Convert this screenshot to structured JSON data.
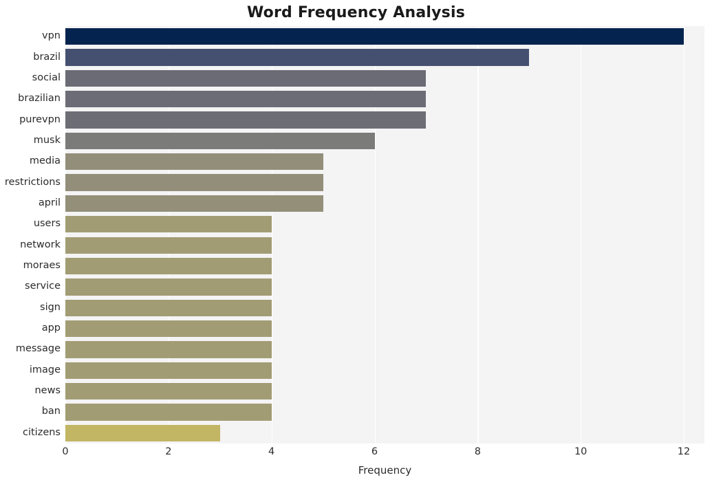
{
  "chart_data": {
    "type": "bar",
    "orientation": "horizontal",
    "title": "Word Frequency Analysis",
    "xlabel": "Frequency",
    "ylabel": "",
    "categories": [
      "vpn",
      "brazil",
      "social",
      "brazilian",
      "purevpn",
      "musk",
      "media",
      "restrictions",
      "april",
      "users",
      "network",
      "moraes",
      "service",
      "sign",
      "app",
      "message",
      "image",
      "news",
      "ban",
      "citizens"
    ],
    "values": [
      12,
      9,
      7,
      7,
      7,
      6,
      5,
      5,
      5,
      4,
      4,
      4,
      4,
      4,
      4,
      4,
      4,
      4,
      4,
      3
    ],
    "xlim": [
      0,
      12.4
    ],
    "xticks": [
      "0",
      "2",
      "4",
      "6",
      "8",
      "10",
      "12"
    ],
    "xtick_values": [
      0,
      2,
      4,
      6,
      8,
      10,
      12
    ],
    "grid": true,
    "legend": false,
    "bar_colors": [
      "#04244f",
      "#455071",
      "#6a6b74",
      "#6b6c75",
      "#6c6d75",
      "#7b7c79",
      "#938e79",
      "#938e79",
      "#938f79",
      "#a29c74",
      "#a29c74",
      "#a29c74",
      "#a29c74",
      "#a29c74",
      "#a29c74",
      "#a29c74",
      "#a29c74",
      "#a29c74",
      "#a29c74",
      "#c2b563"
    ],
    "plot_background": "#f4f4f5",
    "grid_color": "#ffffff",
    "figure_background": "#ffffff",
    "text_color": "#2b2b2b"
  }
}
